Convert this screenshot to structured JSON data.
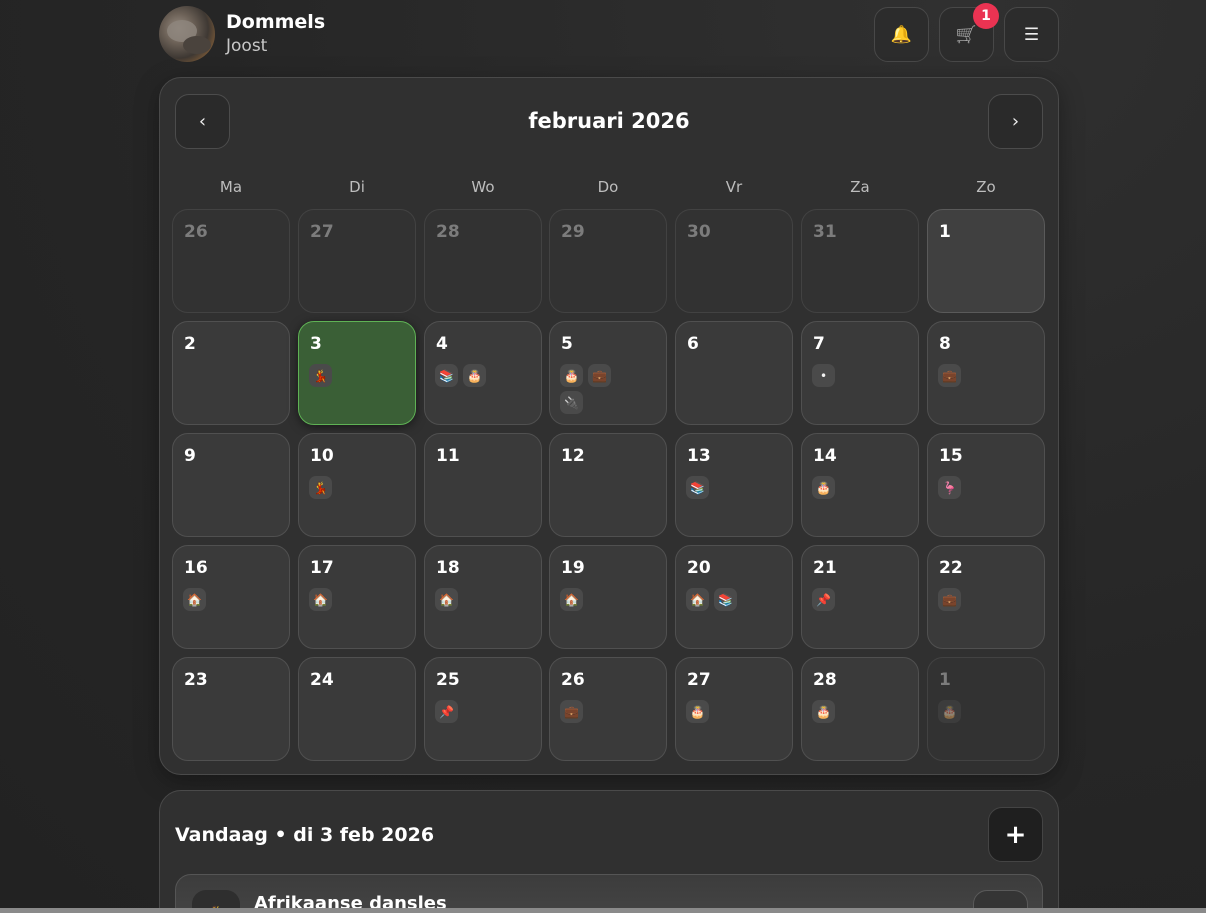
{
  "header": {
    "app_name": "Dommels",
    "user_name": "Joost",
    "bell_icon": "🔔",
    "shopping_icon": "🛒",
    "shopping_badge": "1",
    "menu_icon": "☰"
  },
  "calendar": {
    "month_title": "februari 2026",
    "prev_label": "‹",
    "next_label": "›",
    "weekdays": [
      "Ma",
      "Di",
      "Wo",
      "Do",
      "Vr",
      "Za",
      "Zo"
    ],
    "days": [
      {
        "num": "26",
        "other": true,
        "events": []
      },
      {
        "num": "27",
        "other": true,
        "events": []
      },
      {
        "num": "28",
        "other": true,
        "events": []
      },
      {
        "num": "29",
        "other": true,
        "events": []
      },
      {
        "num": "30",
        "other": true,
        "events": []
      },
      {
        "num": "31",
        "other": true,
        "events": []
      },
      {
        "num": "1",
        "bright": true,
        "events": []
      },
      {
        "num": "2",
        "events": []
      },
      {
        "num": "3",
        "today": true,
        "events": [
          "💃"
        ]
      },
      {
        "num": "4",
        "events": [
          "📚",
          "🎂"
        ]
      },
      {
        "num": "5",
        "events": [
          "🎂",
          "💼",
          "🔌"
        ]
      },
      {
        "num": "6",
        "events": []
      },
      {
        "num": "7",
        "events": [
          "•"
        ]
      },
      {
        "num": "8",
        "events": [
          "💼"
        ]
      },
      {
        "num": "9",
        "events": []
      },
      {
        "num": "10",
        "events": [
          "💃"
        ]
      },
      {
        "num": "11",
        "events": []
      },
      {
        "num": "12",
        "events": []
      },
      {
        "num": "13",
        "events": [
          "📚"
        ]
      },
      {
        "num": "14",
        "events": [
          "🎂"
        ]
      },
      {
        "num": "15",
        "events": [
          "🦩"
        ]
      },
      {
        "num": "16",
        "events": [
          "🏠"
        ]
      },
      {
        "num": "17",
        "events": [
          "🏠"
        ]
      },
      {
        "num": "18",
        "events": [
          "🏠"
        ]
      },
      {
        "num": "19",
        "events": [
          "🏠"
        ]
      },
      {
        "num": "20",
        "events": [
          "🏠",
          "📚"
        ]
      },
      {
        "num": "21",
        "events": [
          "📌"
        ]
      },
      {
        "num": "22",
        "events": [
          "💼"
        ]
      },
      {
        "num": "23",
        "events": []
      },
      {
        "num": "24",
        "events": []
      },
      {
        "num": "25",
        "events": [
          "📌"
        ]
      },
      {
        "num": "26",
        "events": [
          "💼"
        ]
      },
      {
        "num": "27",
        "events": [
          "🎂"
        ]
      },
      {
        "num": "28",
        "events": [
          "🎂"
        ]
      },
      {
        "num": "1",
        "other": true,
        "events": [
          "🎂"
        ]
      }
    ]
  },
  "today": {
    "title": "Vandaag • di 3 feb 2026",
    "add_label": "+",
    "event_icon": "💃",
    "event_name": "Afrikaanse dansles"
  }
}
